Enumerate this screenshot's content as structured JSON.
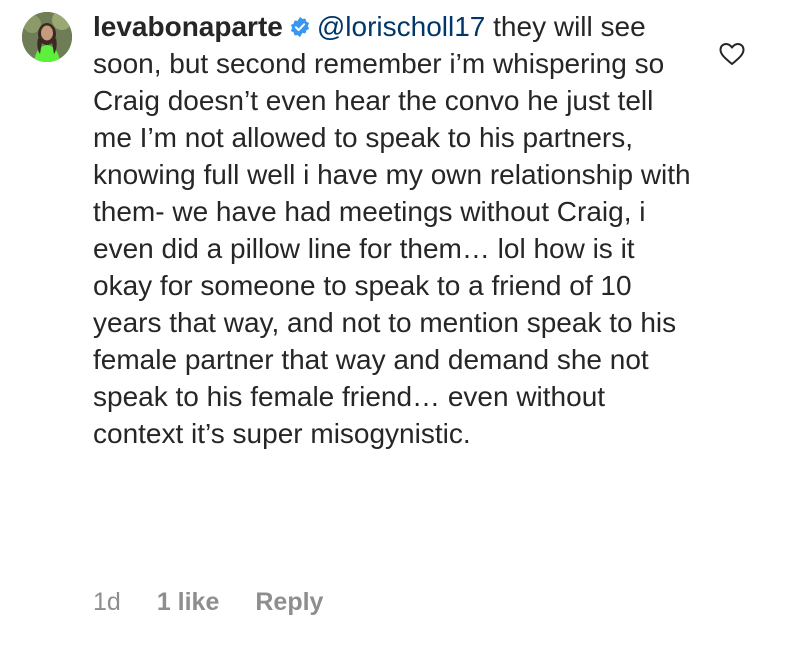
{
  "comment": {
    "username": "levabonaparte",
    "mention": "@lorischoll17",
    "text": " they will see soon, but second remember i’m whispering so Craig doesn’t even hear the convo he just tell me I’m not allowed to speak to his partners, knowing full well i have my own relationship with them- we have had meetings without Craig, i even did a pillow line for them… lol how is it okay for someone to speak to a friend of 10 years that way, and not to mention speak to his female partner that way and demand she not speak to his female friend… even without context it’s super misogynistic.",
    "verified_icon": "verified-badge-icon",
    "like_icon": "heart-outline-icon"
  },
  "meta": {
    "age": "1d",
    "likes": "1 like",
    "reply": "Reply"
  },
  "colors": {
    "text": "#262626",
    "mention": "#00376b",
    "secondary": "#8e8e8e",
    "verified": "#3897f0"
  }
}
